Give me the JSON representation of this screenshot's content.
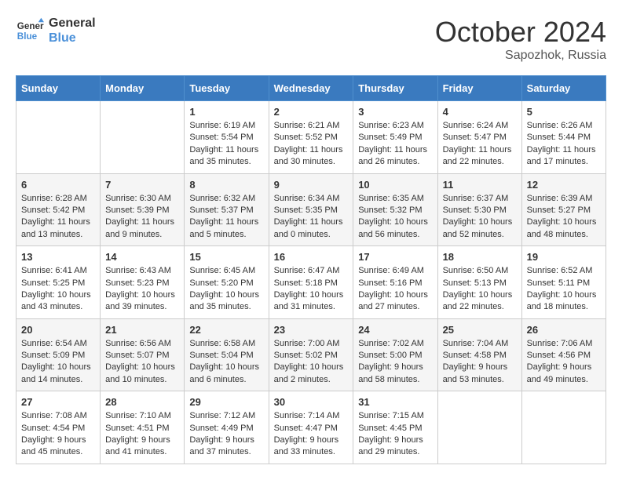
{
  "header": {
    "logo_line1": "General",
    "logo_line2": "Blue",
    "month": "October 2024",
    "location": "Sapozhok, Russia"
  },
  "days_of_week": [
    "Sunday",
    "Monday",
    "Tuesday",
    "Wednesday",
    "Thursday",
    "Friday",
    "Saturday"
  ],
  "weeks": [
    [
      {
        "day": "",
        "info": ""
      },
      {
        "day": "",
        "info": ""
      },
      {
        "day": "1",
        "info": "Sunrise: 6:19 AM\nSunset: 5:54 PM\nDaylight: 11 hours and 35 minutes."
      },
      {
        "day": "2",
        "info": "Sunrise: 6:21 AM\nSunset: 5:52 PM\nDaylight: 11 hours and 30 minutes."
      },
      {
        "day": "3",
        "info": "Sunrise: 6:23 AM\nSunset: 5:49 PM\nDaylight: 11 hours and 26 minutes."
      },
      {
        "day": "4",
        "info": "Sunrise: 6:24 AM\nSunset: 5:47 PM\nDaylight: 11 hours and 22 minutes."
      },
      {
        "day": "5",
        "info": "Sunrise: 6:26 AM\nSunset: 5:44 PM\nDaylight: 11 hours and 17 minutes."
      }
    ],
    [
      {
        "day": "6",
        "info": "Sunrise: 6:28 AM\nSunset: 5:42 PM\nDaylight: 11 hours and 13 minutes."
      },
      {
        "day": "7",
        "info": "Sunrise: 6:30 AM\nSunset: 5:39 PM\nDaylight: 11 hours and 9 minutes."
      },
      {
        "day": "8",
        "info": "Sunrise: 6:32 AM\nSunset: 5:37 PM\nDaylight: 11 hours and 5 minutes."
      },
      {
        "day": "9",
        "info": "Sunrise: 6:34 AM\nSunset: 5:35 PM\nDaylight: 11 hours and 0 minutes."
      },
      {
        "day": "10",
        "info": "Sunrise: 6:35 AM\nSunset: 5:32 PM\nDaylight: 10 hours and 56 minutes."
      },
      {
        "day": "11",
        "info": "Sunrise: 6:37 AM\nSunset: 5:30 PM\nDaylight: 10 hours and 52 minutes."
      },
      {
        "day": "12",
        "info": "Sunrise: 6:39 AM\nSunset: 5:27 PM\nDaylight: 10 hours and 48 minutes."
      }
    ],
    [
      {
        "day": "13",
        "info": "Sunrise: 6:41 AM\nSunset: 5:25 PM\nDaylight: 10 hours and 43 minutes."
      },
      {
        "day": "14",
        "info": "Sunrise: 6:43 AM\nSunset: 5:23 PM\nDaylight: 10 hours and 39 minutes."
      },
      {
        "day": "15",
        "info": "Sunrise: 6:45 AM\nSunset: 5:20 PM\nDaylight: 10 hours and 35 minutes."
      },
      {
        "day": "16",
        "info": "Sunrise: 6:47 AM\nSunset: 5:18 PM\nDaylight: 10 hours and 31 minutes."
      },
      {
        "day": "17",
        "info": "Sunrise: 6:49 AM\nSunset: 5:16 PM\nDaylight: 10 hours and 27 minutes."
      },
      {
        "day": "18",
        "info": "Sunrise: 6:50 AM\nSunset: 5:13 PM\nDaylight: 10 hours and 22 minutes."
      },
      {
        "day": "19",
        "info": "Sunrise: 6:52 AM\nSunset: 5:11 PM\nDaylight: 10 hours and 18 minutes."
      }
    ],
    [
      {
        "day": "20",
        "info": "Sunrise: 6:54 AM\nSunset: 5:09 PM\nDaylight: 10 hours and 14 minutes."
      },
      {
        "day": "21",
        "info": "Sunrise: 6:56 AM\nSunset: 5:07 PM\nDaylight: 10 hours and 10 minutes."
      },
      {
        "day": "22",
        "info": "Sunrise: 6:58 AM\nSunset: 5:04 PM\nDaylight: 10 hours and 6 minutes."
      },
      {
        "day": "23",
        "info": "Sunrise: 7:00 AM\nSunset: 5:02 PM\nDaylight: 10 hours and 2 minutes."
      },
      {
        "day": "24",
        "info": "Sunrise: 7:02 AM\nSunset: 5:00 PM\nDaylight: 9 hours and 58 minutes."
      },
      {
        "day": "25",
        "info": "Sunrise: 7:04 AM\nSunset: 4:58 PM\nDaylight: 9 hours and 53 minutes."
      },
      {
        "day": "26",
        "info": "Sunrise: 7:06 AM\nSunset: 4:56 PM\nDaylight: 9 hours and 49 minutes."
      }
    ],
    [
      {
        "day": "27",
        "info": "Sunrise: 7:08 AM\nSunset: 4:54 PM\nDaylight: 9 hours and 45 minutes."
      },
      {
        "day": "28",
        "info": "Sunrise: 7:10 AM\nSunset: 4:51 PM\nDaylight: 9 hours and 41 minutes."
      },
      {
        "day": "29",
        "info": "Sunrise: 7:12 AM\nSunset: 4:49 PM\nDaylight: 9 hours and 37 minutes."
      },
      {
        "day": "30",
        "info": "Sunrise: 7:14 AM\nSunset: 4:47 PM\nDaylight: 9 hours and 33 minutes."
      },
      {
        "day": "31",
        "info": "Sunrise: 7:15 AM\nSunset: 4:45 PM\nDaylight: 9 hours and 29 minutes."
      },
      {
        "day": "",
        "info": ""
      },
      {
        "day": "",
        "info": ""
      }
    ]
  ]
}
